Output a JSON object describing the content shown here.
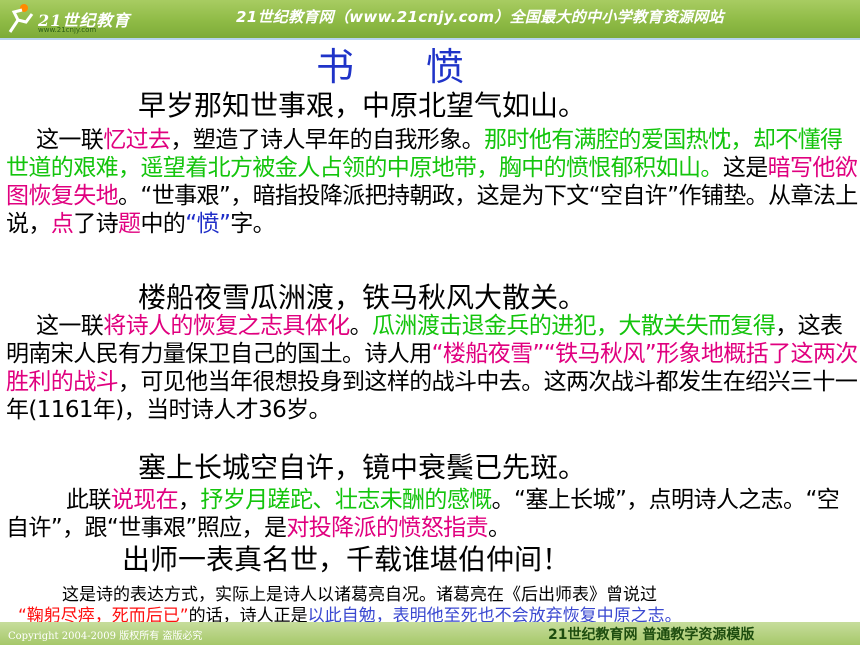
{
  "header": {
    "logo_text": "21世纪教育",
    "logo_url": "www.21cnjy.com",
    "tagline": "21世纪教育网（www.21cnjy.com）全国最大的中小学教育资源网站"
  },
  "title": "书愤",
  "poem": {
    "line1": "早岁那知世事艰，中原北望气如山。",
    "line2": "楼船夜雪瓜洲渡，铁马秋风大散关。",
    "line3": "塞上长城空自许，镜中衰鬓已先斑。",
    "line4": "出师一表真名世，千载谁堪伯仲间！"
  },
  "para1": {
    "s1": "这一联",
    "s2": "忆过去",
    "s3": "，塑造了诗人早年的自我形象。",
    "s4": "那时他有满腔的爱国热忱，却不懂得世道的艰难，遥望着北方被金人占领的中原地带，胸中的愤恨郁积如山。",
    "s5": "这是",
    "s6": "暗写他欲图恢复失地",
    "s7": "。“世事艰”，暗指投降派把持朝政，这是为下文“空自许”作铺垫。从章法上说，",
    "s8": "点",
    "s9": "了诗",
    "s10": "题",
    "s11": "中的",
    "s12": "“愤”",
    "s13": "字。"
  },
  "para2": {
    "s1": "这一联",
    "s2": "将诗人的恢复之志具体化",
    "s3": "。",
    "s4": "瓜洲渡击退金兵的进犯，大散关失而复得",
    "s5": "，这表明南宋人民有力量保卫自己的国土。诗人用",
    "s6": "“楼船夜雪”“铁马秋风”形象地概括了这两次胜利的战斗",
    "s7": "，可见他当年很想投身到这样的战斗中去。这两次战斗都发生在绍兴三十一年(1161年)，当时诗人才36岁。"
  },
  "para3": {
    "s1": "此联",
    "s2": "说现在",
    "s3": "，",
    "s4": "抒岁月蹉跎、壮志未酬的感慨",
    "s5": "。“塞上长城”，点明诗人之志。“空自许”，跟“世事艰”照应，是",
    "s6": "对投降派的愤怒指责",
    "s7": "。"
  },
  "para4": {
    "s1": "这是诗的表达方式，实际上是诗人以诸葛亮自况。诸葛亮在《后出师表》曾说过",
    "s2": "“鞠躬尽瘁，死而后已”",
    "s3": "的话，诗人正是",
    "s4": "以此自勉，表明他至死也不会放弃恢复中原之志。"
  },
  "footer": {
    "copyright": "Copyright 2004-2009 版权所有 盗版必究",
    "right": "21世纪教育网   普通教学资源模版"
  },
  "colors": {
    "title": "#1f33c8",
    "highlight_magenta": "#e0007f",
    "highlight_green": "#13c40c",
    "highlight_red": "#ff1010",
    "highlight_blue": "#1e2dc8",
    "header_green": "#8fbb46"
  }
}
